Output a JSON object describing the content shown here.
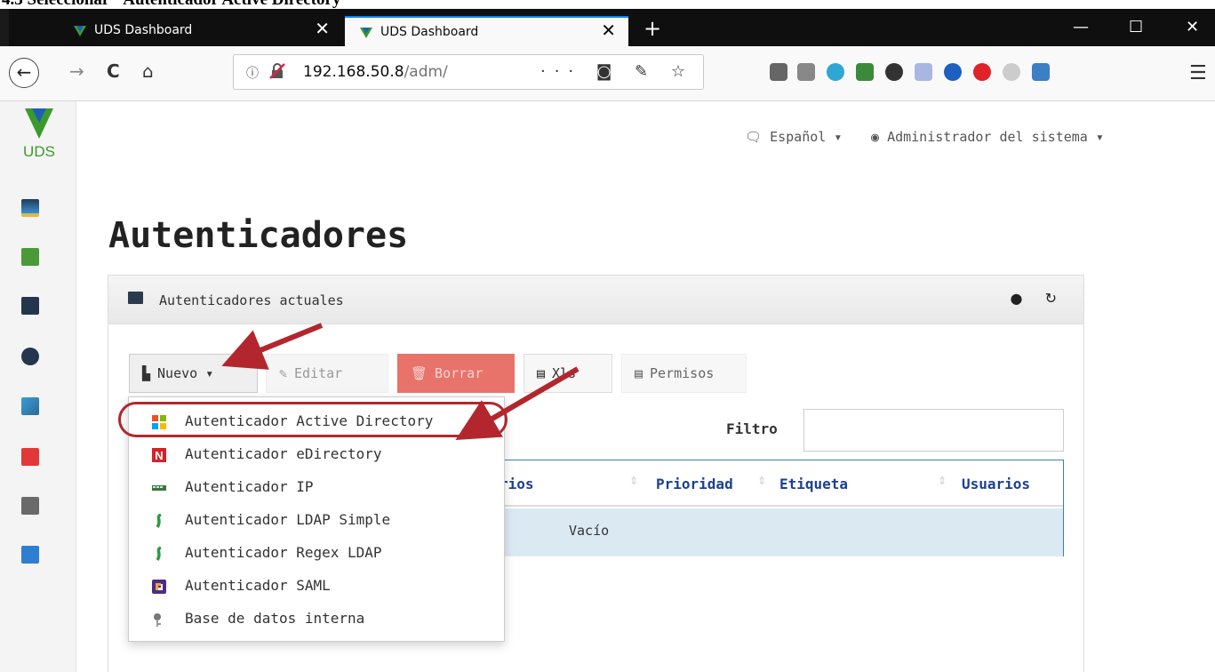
{
  "doc_heading": "4.3 Seleccionar \"Autenticador Active Directory\"",
  "browser": {
    "tabs": [
      {
        "title": "UDS Dashboard",
        "active": false
      },
      {
        "title": "UDS Dashboard",
        "active": true
      }
    ],
    "new_tab_glyph": "+",
    "close_glyph": "✕",
    "window_controls": {
      "minimize": "—",
      "maximize": "☐",
      "close": "✕"
    },
    "back_glyph": "←",
    "forward_glyph": "→",
    "reload_glyph": "C",
    "home_glyph": "⌂",
    "url_info_glyph": "ⓘ",
    "url_host": "192.168.50.8",
    "url_path": "/adm/",
    "url_actions": "··· ◙ ✎ ☆",
    "hamburger_glyph": "☰"
  },
  "app": {
    "logo_text": "UDS",
    "language_menu": "Español",
    "user_menu": "Administrador del sistema",
    "page_title": "Autenticadores",
    "panel_title": "Autenticadores actuales",
    "panel_controls": "● ↻",
    "toolbar": {
      "nuevo": "Nuevo",
      "editar": "Editar",
      "borrar": "Borrar",
      "xls": "Xls",
      "permisos": "Permisos"
    },
    "filter_label": "Filtro",
    "filter_value": "",
    "table": {
      "columns": [
        "Usuarios",
        "Prioridad",
        "Etiqueta",
        "Usuarios"
      ],
      "partial_first_column": "rios",
      "empty_text": "Vacío"
    },
    "dropdown_items": [
      {
        "label": "Autenticador Active Directory",
        "icon": "windows-icon"
      },
      {
        "label": "Autenticador eDirectory",
        "icon": "novell-icon"
      },
      {
        "label": "Autenticador IP",
        "icon": "ip-icon"
      },
      {
        "label": "Autenticador LDAP Simple",
        "icon": "ldap-icon"
      },
      {
        "label": "Autenticador Regex LDAP",
        "icon": "regex-ldap-icon"
      },
      {
        "label": "Autenticador SAML",
        "icon": "saml-icon"
      },
      {
        "label": "Base de datos interna",
        "icon": "database-icon"
      }
    ]
  },
  "colors": {
    "accent": "#0a84ff",
    "annotation": "#b3262d",
    "link_blue": "#1c3f95",
    "danger": "#e8736b"
  }
}
